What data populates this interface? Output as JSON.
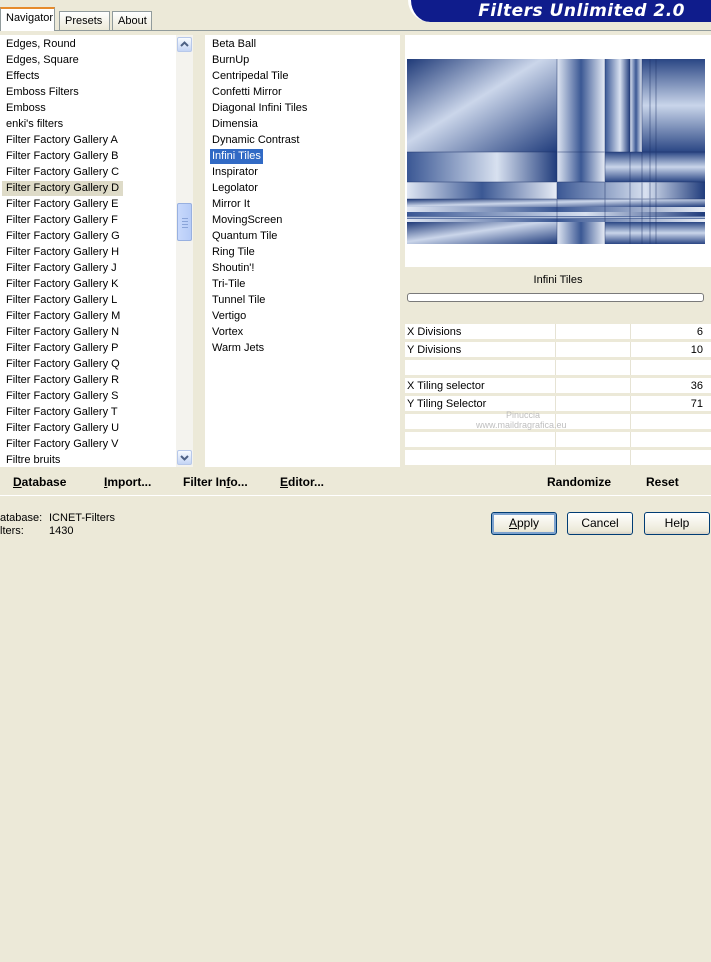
{
  "tabs": [
    {
      "label": "Navigator",
      "active": true
    },
    {
      "label": "Presets",
      "active": false
    },
    {
      "label": "About",
      "active": false
    }
  ],
  "banner": {
    "title": "Filters Unlimited 2.0",
    "color": "#0f1c8c"
  },
  "categories": {
    "items": [
      "Edges, Round",
      "Edges, Square",
      "Effects",
      "Emboss Filters",
      "Emboss",
      "enki's filters",
      "Filter Factory Gallery A",
      "Filter Factory Gallery B",
      "Filter Factory Gallery C",
      "Filter Factory Gallery D",
      "Filter Factory Gallery E",
      "Filter Factory Gallery F",
      "Filter Factory Gallery G",
      "Filter Factory Gallery H",
      "Filter Factory Gallery J",
      "Filter Factory Gallery K",
      "Filter Factory Gallery L",
      "Filter Factory Gallery M",
      "Filter Factory Gallery N",
      "Filter Factory Gallery P",
      "Filter Factory Gallery Q",
      "Filter Factory Gallery R",
      "Filter Factory Gallery S",
      "Filter Factory Gallery T",
      "Filter Factory Gallery U",
      "Filter Factory Gallery V",
      "Filtre bruits"
    ],
    "selected": "Filter Factory Gallery D"
  },
  "filters": {
    "items": [
      "Beta Ball",
      "BurnUp",
      "Centripedal Tile",
      "Confetti Mirror",
      "Diagonal Infini Tiles",
      "Dimensia",
      "Dynamic Contrast",
      "Infini Tiles",
      "Inspirator",
      "Legolator",
      "Mirror It",
      "MovingScreen",
      "Quantum Tile",
      "Ring Tile",
      "Shoutin'!",
      "Tri-Tile",
      "Tunnel Tile",
      "Vertigo",
      "Vortex",
      "Warm Jets"
    ],
    "selected": "Infini Tiles"
  },
  "filter_name": "Infini Tiles",
  "params": [
    {
      "label": "X Divisions",
      "value": "6"
    },
    {
      "label": "Y Divisions",
      "value": "10"
    },
    {
      "label": "",
      "value": ""
    },
    {
      "label": "X Tiling selector",
      "value": "36"
    },
    {
      "label": "Y Tiling Selector",
      "value": "71"
    },
    {
      "label": "",
      "value": ""
    },
    {
      "label": "",
      "value": ""
    },
    {
      "label": "",
      "value": ""
    }
  ],
  "bottom_links": {
    "database": "Database",
    "import": "Import...",
    "filter_info": "Filter Info...",
    "editor": "Editor...",
    "randomize": "Randomize",
    "reset": "Reset"
  },
  "status": {
    "database_label": "atabase:",
    "database_value": "ICNET-Filters",
    "filters_label": "lters:",
    "filters_value": "1430"
  },
  "buttons": {
    "apply": "Apply",
    "cancel": "Cancel",
    "help": "Help"
  },
  "watermark": {
    "line1": "Pinuccia",
    "line2": "www.maildragrafica.eu"
  },
  "colors": {
    "selection": "#316ac5",
    "category_selected": "#dedbc8",
    "preview_blue": "#2e4a8a"
  }
}
